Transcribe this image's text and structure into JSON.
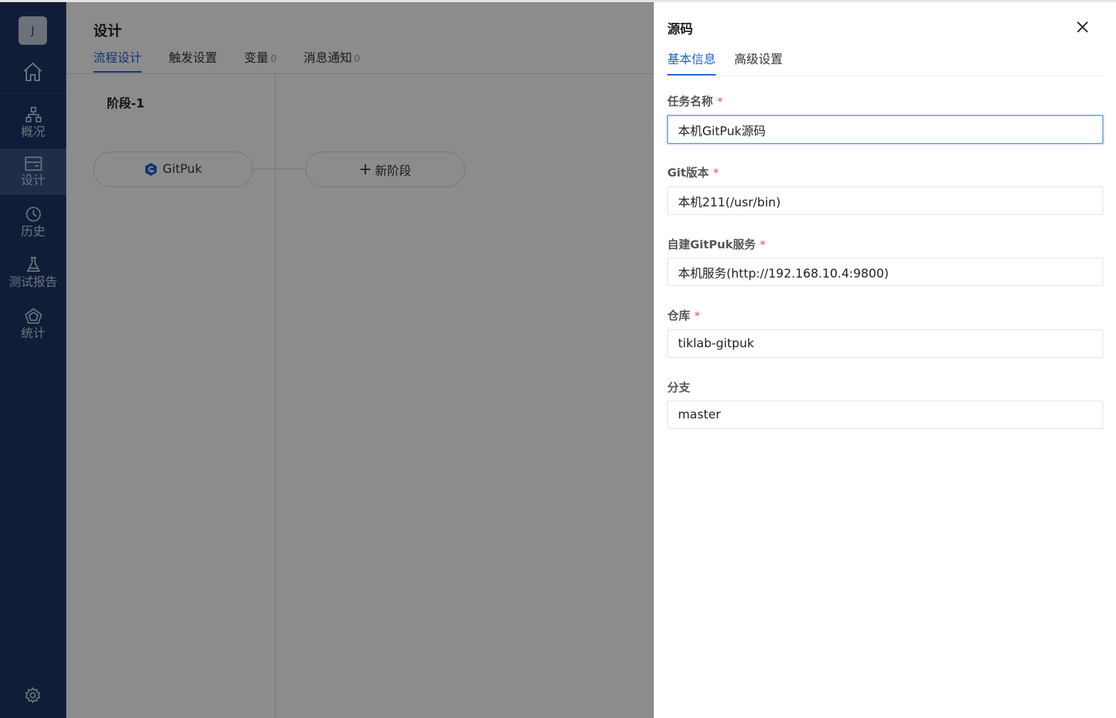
{
  "sidebar": {
    "avatar": "J",
    "items": [
      {
        "label": "概况"
      },
      {
        "label": "设计"
      },
      {
        "label": "历史"
      },
      {
        "label": "测试报告"
      },
      {
        "label": "统计"
      }
    ]
  },
  "main": {
    "title": "设计",
    "tabs": [
      {
        "label": "流程设计",
        "count": ""
      },
      {
        "label": "触发设置",
        "count": ""
      },
      {
        "label": "变量",
        "count": "0"
      },
      {
        "label": "消息通知",
        "count": "0"
      }
    ],
    "stage_title": "阶段-1",
    "task_label": "GitPuk",
    "new_stage_label": "新阶段"
  },
  "drawer": {
    "title": "源码",
    "tabs": [
      {
        "label": "基本信息"
      },
      {
        "label": "高级设置"
      }
    ],
    "fields": [
      {
        "label": "任务名称",
        "required": "*",
        "value": "本机GitPuk源码"
      },
      {
        "label": "Git版本",
        "required": "*",
        "value": "本机211(/usr/bin)"
      },
      {
        "label": "自建GitPuk服务",
        "required": "*",
        "value": "本机服务(http://192.168.10.4:9800)"
      },
      {
        "label": "仓库",
        "required": "*",
        "value": "tiklab-gitpuk"
      },
      {
        "label": "分支",
        "required": "",
        "value": "master"
      }
    ]
  },
  "colors": {
    "sidebar_bg": "#1d3668",
    "accent": "#1e5fd0",
    "required": "#e34b4b"
  }
}
